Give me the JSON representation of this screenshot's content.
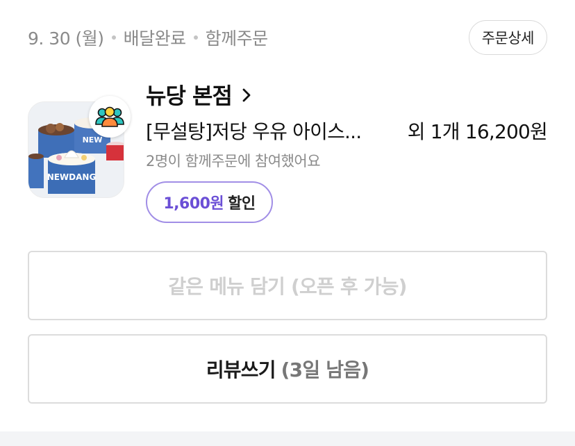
{
  "order": {
    "date": "9. 30 (월)",
    "status": "배달완료",
    "order_type": "함께주문",
    "detail_button": "주문상세"
  },
  "store": {
    "name": "뉴당 본점"
  },
  "menu": {
    "name": "[무설탕]저당 우유 아이스...",
    "extra_and_price": "외 1개 16,200원"
  },
  "group_note": "2명이 함께주문에 참여했어요",
  "discount": {
    "amount": "1,600원",
    "label": "할인"
  },
  "actions": {
    "reorder": "같은 메뉴 담기 (오픈 후 가능)",
    "review": "리뷰쓰기",
    "review_remaining": "(3일 남음)"
  },
  "colors": {
    "accent_purple": "#6b4fd6",
    "pill_border": "#a18ee6",
    "muted_text": "#8a8a8a",
    "disabled_text": "#cfcfcf"
  }
}
